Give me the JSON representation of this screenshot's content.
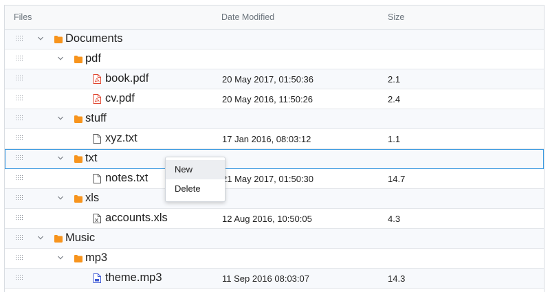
{
  "header": {
    "files": "Files",
    "date_modified": "Date Modified",
    "size": "Size"
  },
  "rows": [
    {
      "name": "Documents",
      "type": "folder",
      "level": 0,
      "expanded": true,
      "date": "",
      "size": ""
    },
    {
      "name": "pdf",
      "type": "folder",
      "level": 1,
      "expanded": true,
      "date": "",
      "size": ""
    },
    {
      "name": "book.pdf",
      "type": "pdf",
      "level": 2,
      "date": "20 May 2017, 01:50:36",
      "size": "2.1"
    },
    {
      "name": "cv.pdf",
      "type": "pdf",
      "level": 2,
      "date": "20 May 2016, 11:50:26",
      "size": "2.4"
    },
    {
      "name": "stuff",
      "type": "folder",
      "level": 1,
      "expanded": true,
      "date": "",
      "size": ""
    },
    {
      "name": "xyz.txt",
      "type": "txt",
      "level": 2,
      "date": "17 Jan 2016, 08:03:12",
      "size": "1.1"
    },
    {
      "name": "txt",
      "type": "folder",
      "level": 1,
      "expanded": true,
      "selected": true,
      "date": "",
      "size": ""
    },
    {
      "name": "notes.txt",
      "type": "txt",
      "level": 2,
      "date": "21 May 2017, 01:50:30",
      "size": "14.7"
    },
    {
      "name": "xls",
      "type": "folder",
      "level": 1,
      "expanded": true,
      "date": "",
      "size": ""
    },
    {
      "name": "accounts.xls",
      "type": "xls",
      "level": 2,
      "date": "12 Aug 2016, 10:50:05",
      "size": "4.3"
    },
    {
      "name": "Music",
      "type": "folder",
      "level": 0,
      "expanded": true,
      "date": "",
      "size": ""
    },
    {
      "name": "mp3",
      "type": "folder",
      "level": 1,
      "expanded": true,
      "date": "",
      "size": ""
    },
    {
      "name": "theme.mp3",
      "type": "mp3",
      "level": 2,
      "date": "11 Sep 2016 08:03:07",
      "size": "14.3"
    }
  ],
  "context_menu": {
    "items": [
      {
        "label": "New",
        "highlighted": true
      },
      {
        "label": "Delete",
        "highlighted": false
      }
    ]
  },
  "colors": {
    "folder": "#f7941d",
    "pdf": "#e0452f",
    "file": "#555555",
    "mp3": "#3f5bd6",
    "selection": "#3c9ae0"
  },
  "icons": {
    "folder": "folder-icon",
    "pdf": "pdf-file-icon",
    "txt": "text-file-icon",
    "xls": "excel-file-icon",
    "mp3": "audio-file-icon",
    "expand": "chevron-down-icon",
    "drag": "drag-handle-icon"
  }
}
